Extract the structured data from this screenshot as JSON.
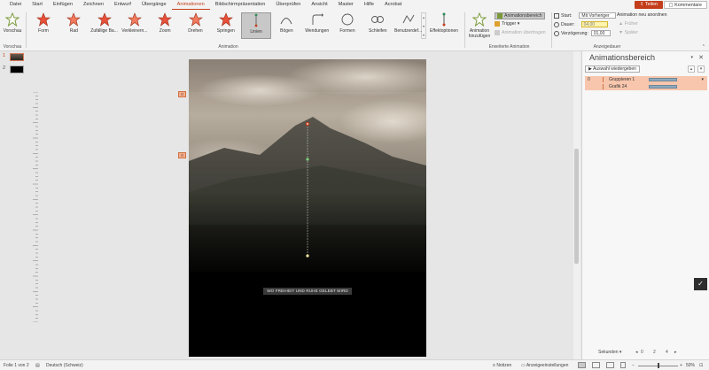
{
  "menu": {
    "tabs": [
      "Datei",
      "Start",
      "Einfügen",
      "Zeichnen",
      "Entwurf",
      "Übergänge",
      "Animationen",
      "Bildschirmpräsentation",
      "Überprüfen",
      "Ansicht",
      "Master",
      "Hilfe",
      "Acrobat"
    ],
    "active_tab": "Animationen",
    "share_label": "Teilen",
    "comments_label": "Kommentare"
  },
  "ribbon": {
    "preview_label": "Vorschau",
    "preview_group": "Vorschau",
    "animations_group": "Animation",
    "effects": [
      {
        "label": "Form",
        "icon": "star-icon"
      },
      {
        "label": "Rad",
        "icon": "star-icon"
      },
      {
        "label": "Zufällige Ba...",
        "icon": "star-icon"
      },
      {
        "label": "Verkleinern...",
        "icon": "star-icon"
      },
      {
        "label": "Zoom",
        "icon": "star-icon"
      },
      {
        "label": "Drehen",
        "icon": "star-icon"
      },
      {
        "label": "Springen",
        "icon": "star-icon"
      },
      {
        "label": "Linien",
        "icon": "line-path-icon"
      },
      {
        "label": "Bögen",
        "icon": "arc-path-icon"
      },
      {
        "label": "Wendungen",
        "icon": "turn-path-icon"
      },
      {
        "label": "Formen",
        "icon": "circle-path-icon"
      },
      {
        "label": "Schleifen",
        "icon": "loop-path-icon"
      },
      {
        "label": "Benutzerdef...",
        "icon": "custom-path-icon"
      }
    ],
    "active_effect": "Linien",
    "effect_options_label": "Effektoptionen",
    "add_animation_label": "Animation hinzufügen",
    "advanced_group": "Erweiterte Animation",
    "anim_pane_label": "Animationsbereich",
    "trigger_label": "Trigger",
    "anim_painter_label": "Animation übertragen",
    "start_label": "Start:",
    "start_value": "Mit Vorheriger",
    "duration_label": "Dauer:",
    "duration_value": "04,00",
    "delay_label": "Verzögerung:",
    "delay_value": "01,00",
    "reorder_label": "Animation neu anordnen",
    "earlier_label": "Früher",
    "later_label": "Später",
    "timing_group": "Anzeigedauer"
  },
  "slides": {
    "items": [
      {
        "number": "1"
      },
      {
        "number": "2"
      }
    ],
    "selected": "1"
  },
  "slide": {
    "caption": "WO FREIHEIT UND RUHE GELEBT WIRD",
    "anim_tags": [
      "0",
      "0"
    ]
  },
  "anim_pane": {
    "title": "Animationsbereich",
    "play_label": "Auswahl wiedergeben",
    "items": [
      {
        "num": "0",
        "name": "Gruppieren 1"
      },
      {
        "num": "",
        "name": "Grafik 24"
      }
    ],
    "seconds_label": "Sekunden",
    "ticks": [
      "0",
      "2",
      "4"
    ]
  },
  "status": {
    "slide_info": "Folie 1 von 2",
    "language": "Deutsch (Schweiz)",
    "notes_label": "Notizen",
    "display_settings_label": "Anzeigeeinstellungen",
    "zoom": "50%"
  }
}
